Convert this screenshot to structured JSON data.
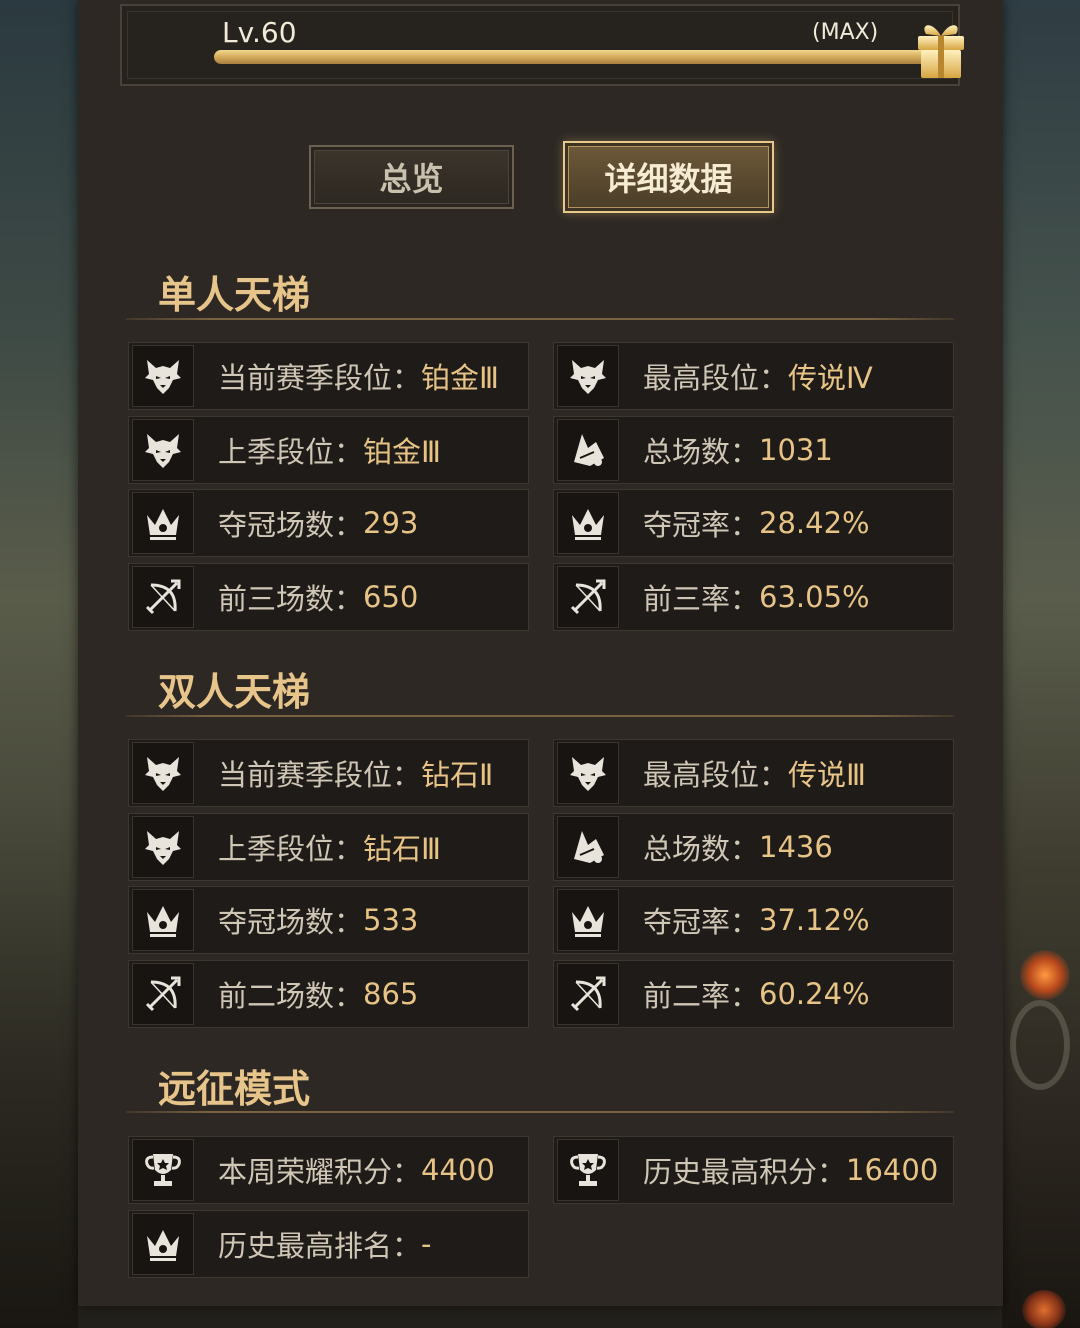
{
  "level": {
    "label": "Lv.60",
    "max_label": "(MAX)",
    "progress": 1.0
  },
  "tabs": {
    "overview": "总览",
    "detail": "详细数据",
    "active": "detail"
  },
  "solo": {
    "title": "单人天梯",
    "stats": [
      {
        "icon": "wolf-icon",
        "label": "当前赛季段位：",
        "value": "铂金Ⅲ"
      },
      {
        "icon": "wolf-icon",
        "label": "最高段位：",
        "value": "传说Ⅳ"
      },
      {
        "icon": "wolf-icon",
        "label": "上季段位：",
        "value": "铂金Ⅲ"
      },
      {
        "icon": "scroll-icon",
        "label": "总场数：",
        "value": "1031"
      },
      {
        "icon": "crown-icon",
        "label": "夺冠场数：",
        "value": "293"
      },
      {
        "icon": "crown-icon",
        "label": "夺冠率：",
        "value": "28.42%"
      },
      {
        "icon": "bow-icon",
        "label": "前三场数：",
        "value": "650"
      },
      {
        "icon": "bow-icon",
        "label": "前三率：",
        "value": "63.05%"
      }
    ]
  },
  "duo": {
    "title": "双人天梯",
    "stats": [
      {
        "icon": "wolf-icon",
        "label": "当前赛季段位：",
        "value": "钻石Ⅱ"
      },
      {
        "icon": "wolf-icon",
        "label": "最高段位：",
        "value": "传说Ⅲ"
      },
      {
        "icon": "wolf-icon",
        "label": "上季段位：",
        "value": "钻石Ⅲ"
      },
      {
        "icon": "scroll-icon",
        "label": "总场数：",
        "value": "1436"
      },
      {
        "icon": "crown-icon",
        "label": "夺冠场数：",
        "value": "533"
      },
      {
        "icon": "crown-icon",
        "label": "夺冠率：",
        "value": "37.12%"
      },
      {
        "icon": "bow-icon",
        "label": "前二场数：",
        "value": "865"
      },
      {
        "icon": "bow-icon",
        "label": "前二率：",
        "value": "60.24%"
      }
    ]
  },
  "expedition": {
    "title": "远征模式",
    "stats": [
      {
        "icon": "trophy-icon",
        "label": "本周荣耀积分：",
        "value": "4400"
      },
      {
        "icon": "trophy-icon",
        "label": "历史最高积分：",
        "value": "16400"
      },
      {
        "icon": "crown-icon",
        "label": "历史最高排名：",
        "value": "-"
      }
    ]
  },
  "colors": {
    "accent_gold": "#e7c386",
    "panel": "#2d2824",
    "card": "#1f1b18",
    "label_text": "#cfc6b6"
  }
}
